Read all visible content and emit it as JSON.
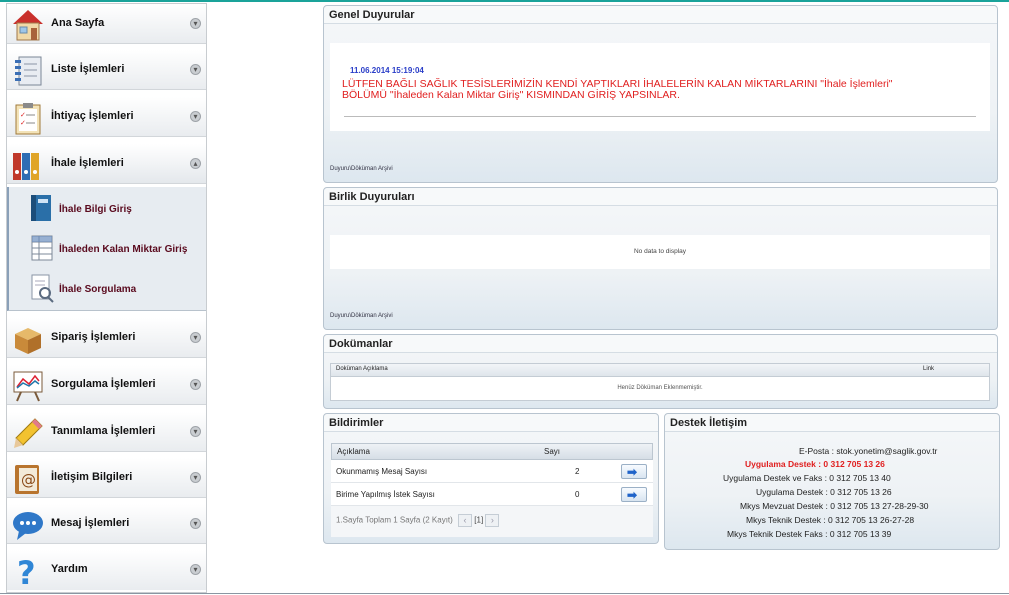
{
  "sidebar": {
    "items": [
      {
        "label": "Ana Sayfa",
        "icon": "house-icon"
      },
      {
        "label": "Liste İşlemleri",
        "icon": "notebook-icon"
      },
      {
        "label": "İhtiyaç İşlemleri",
        "icon": "clipboard-checklist-icon"
      },
      {
        "label": "İhale İşlemleri",
        "icon": "binders-icon"
      },
      {
        "label": "Sipariş İşlemleri",
        "icon": "box-icon"
      },
      {
        "label": "Sorgulama İşlemleri",
        "icon": "chart-easel-icon"
      },
      {
        "label": "Tanımlama İşlemleri",
        "icon": "pencil-icon"
      },
      {
        "label": "İletişim Bilgileri",
        "icon": "address-book-icon"
      },
      {
        "label": "Mesaj İşlemleri",
        "icon": "speech-bubble-icon"
      },
      {
        "label": "Yardım",
        "icon": "question-mark-icon"
      }
    ],
    "subitems": [
      {
        "label": "İhale Bilgi Giriş",
        "icon": "book-icon"
      },
      {
        "label": "İhaleden Kalan Miktar Giriş",
        "icon": "spreadsheet-icon"
      },
      {
        "label": "İhale Sorgulama",
        "icon": "document-search-icon"
      }
    ]
  },
  "genel": {
    "title": "Genel Duyurular",
    "date": "11.06.2014 15:19:04",
    "message_line1": "LÜTFEN BAĞLI SAĞLIK TESİSLERİMİZİN KENDİ YAPTIKLARI İHALELERİN KALAN MİKTARLARINI \"İhale İşlemleri\"",
    "message_line2": "BÖLÜMÜ \"İhaleden Kalan Miktar Giriş\" KISMINDAN GİRİŞ YAPSINLAR.",
    "archive": "Duyuru\\Döküman Arşivi"
  },
  "birlik": {
    "title": "Birlik Duyuruları",
    "empty": "No data to display",
    "archive": "Duyuru\\Döküman Arşivi"
  },
  "dokumanlar": {
    "title": "Dokümanlar",
    "col_desc": "Doküman Açıklama",
    "col_link": "Link",
    "empty": "Henüz Döküman Eklenmemiştir."
  },
  "bildirimler": {
    "title": "Bildirimler",
    "col_desc": "Açıklama",
    "col_count": "Sayı",
    "rows": [
      {
        "label": "Okunmamış Mesaj Sayısı",
        "count": "2"
      },
      {
        "label": "Birime Yapılmış İstek Sayısı",
        "count": "0"
      }
    ],
    "pager_text": "1.Sayfa Toplam 1 Sayfa (2 Kayıt)",
    "pager_page": "[1]"
  },
  "destek": {
    "title": "Destek İletişim",
    "lines": [
      {
        "text": "E-Posta : stok.yonetim@saglik.gov.tr",
        "highlight": false
      },
      {
        "text": "Uygulama Destek : 0 312 705 13 26",
        "highlight": true
      },
      {
        "text": "Uygulama Destek ve Faks : 0 312 705 13 40",
        "highlight": false
      },
      {
        "text": "Uygulama Destek : 0 312 705 13 26",
        "highlight": false
      },
      {
        "text": "Mkys Mevzuat Destek : 0 312 705 13 27-28-29-30",
        "highlight": false
      },
      {
        "text": "Mkys Teknik Destek : 0 312 705 13 26-27-28",
        "highlight": false
      },
      {
        "text": "Mkys Teknik Destek Faks : 0 312 705 13 39",
        "highlight": false
      }
    ]
  },
  "colors": {
    "accent": "#1aa39a",
    "alert_red": "#e01e1e",
    "date_blue": "#2a3ec8",
    "sub_label": "#5a0a1e"
  }
}
